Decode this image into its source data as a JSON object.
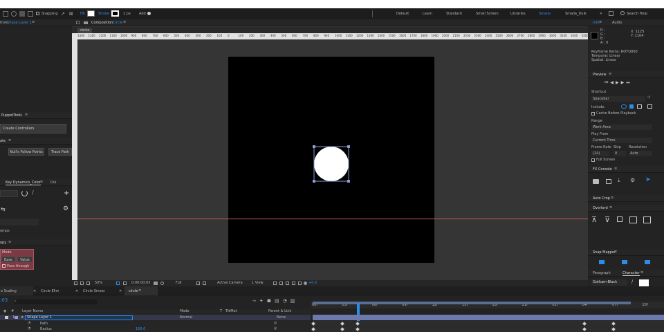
{
  "toolbar": {
    "snapping_label": "Snapping",
    "fill_label": "Fill",
    "stroke_label": "Stroke",
    "stroke_width": "1 px",
    "add_label": "Add",
    "workspaces": [
      "Default",
      "Learn",
      "Standard",
      "Small Screen",
      "Libraries",
      "Smalla",
      "Smalla_Duik"
    ],
    "active_workspace_index": 5,
    "search_label": "Search Help"
  },
  "left": {
    "effects_tab": "trols",
    "effects_layer": "Shape Layer 1",
    "puppet_tab": "PuppetTools",
    "create_controllers": "Create Controllers",
    "other_tab": "ate",
    "motion_follow": "Null's Follow Points",
    "trace_path": "Trace Path",
    "keydynamics_tab": "Key Dynamics_Color",
    "dui_tab": "Dui",
    "comps_label": "omps",
    "copy_tab": "opy",
    "mode_label": "Mode",
    "ease_label": "Ease",
    "value_label": "Value",
    "pass_through": "Pass through"
  },
  "composition": {
    "panel_label": "Composition",
    "comp_name": "Circle",
    "breadcrumb": "circle",
    "ruler_labels": [
      "1400",
      "1300",
      "1200",
      "1100",
      "1000",
      "900",
      "800",
      "700",
      "600",
      "500",
      "400",
      "300",
      "200",
      "100",
      "0",
      "100",
      "200",
      "300",
      "400",
      "500",
      "600",
      "700",
      "800",
      "900",
      "1000",
      "1100",
      "1200",
      "1300",
      "1400",
      "1500",
      "1600",
      "1700",
      "1800",
      "1900",
      "2000",
      "2100",
      "2200",
      "2300",
      "2400",
      "2500",
      "2600",
      "2700",
      "2800",
      "2900",
      "3000",
      "3100",
      "3200",
      "3300"
    ],
    "zoom": "50%",
    "timecode": "0:00:00:03",
    "resolution": "Full",
    "camera": "Active Camera",
    "views": "1 View",
    "exposure": "+0.0"
  },
  "right": {
    "info_tab": "Info",
    "audio_tab": "Audio",
    "info_values": [
      "R :",
      "G :",
      "B :",
      "A : 0"
    ],
    "xy_values": [
      "X: 1125",
      "Y: 1104"
    ],
    "keyframe_info": [
      "Keyframe Items: ROTO000",
      "Temporal: Linear",
      "Spatial: Linear"
    ],
    "preview_tab": "Preview",
    "shortcut_label": "Shortcut",
    "shortcut_value": "Spacebar",
    "include_label": "Include:",
    "cache_label": "Cache Before Playback",
    "range_label": "Range",
    "range_value": "Work Area",
    "play_from_label": "Play From",
    "play_from_value": "Current Time",
    "frame_rate_label": "Frame Rate",
    "skip_label": "Skip",
    "resolution_label": "Resolution",
    "frame_rate_value": "(24)",
    "skip_value": "0",
    "resolution_value": "Auto",
    "full_screen_label": "Full Screen",
    "fxconsole_tab": "FX Console",
    "autocrop_tab": "Auto Crop",
    "overlord_tab": "Overlord",
    "textmapper_tab": "Snap Mapper",
    "paragraph_tab": "Paragraph",
    "character_tab": "Character",
    "font_value": "Gotham-Black"
  },
  "timeline": {
    "tabs": [
      "e Scaling",
      "Circle Ellm",
      "Circle Smear",
      "circle"
    ],
    "active_tab_index": 3,
    "current_time": ":03",
    "columns": [
      "Layer Name",
      "Mode",
      "T",
      "TrkMat",
      "Parent & Link"
    ],
    "layer_number": "1",
    "layer_name": "Shape Layer 1",
    "layer_mode": "Normal",
    "layer_parent": "None",
    "sub_rows": [
      "Path",
      "Radius"
    ],
    "radius_value": "166.0",
    "time_labels": [
      "00f",
      "03f",
      "06f",
      "09f",
      "12f",
      "15f",
      "18f",
      "21f",
      "01f",
      "04f",
      "07f",
      "10f"
    ]
  },
  "colors": {
    "accent": "#2d8ceb",
    "panel": "#232323",
    "canvas": "#000000",
    "layer_label": "#8c9bd6"
  }
}
